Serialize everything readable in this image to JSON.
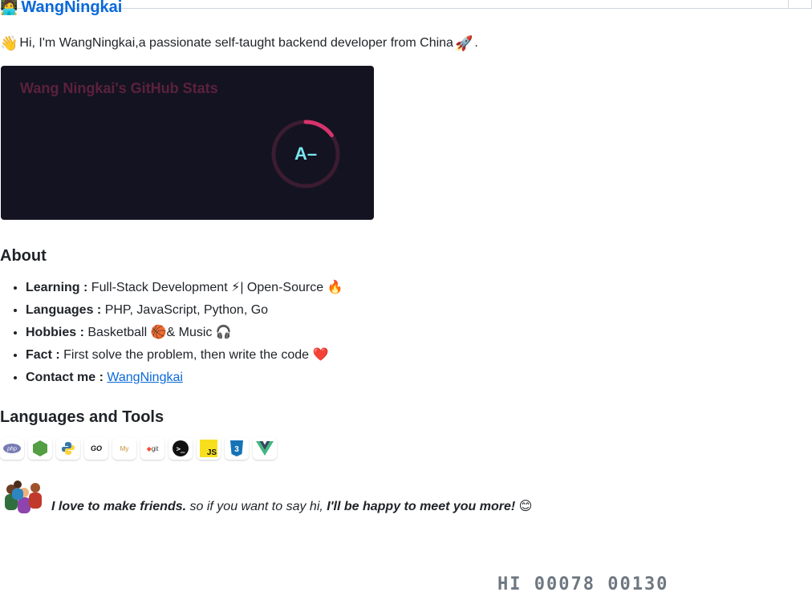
{
  "title": {
    "emoji": "🧑‍💻",
    "text": "WangNingkai"
  },
  "intro": {
    "lead_emoji": "👋",
    "text": "Hi, I'm WangNingkai,a passionate self-taught backend developer from China",
    "trail_emoji": "🚀",
    "trail_punct": "."
  },
  "stats_card": {
    "title": "Wang Ningkai's GitHub Stats",
    "rank": "A–",
    "rank_progress": 0.15,
    "colors": {
      "background": "#141321",
      "title": "#5b213c",
      "ring_track": "#3b1c30",
      "ring_progress": "#d6336c",
      "rank_text": "#79e7f0"
    }
  },
  "about": {
    "heading": "About",
    "items": [
      {
        "label": "Learning :",
        "value": "Full-Stack Development ⚡| Open-Source 🔥"
      },
      {
        "label": "Languages :",
        "value": "PHP, JavaScript, Python, Go"
      },
      {
        "label": "Hobbies :",
        "value": "Basketball 🏀& Music 🎧"
      },
      {
        "label": "Fact :",
        "value": "First solve the problem, then write the code ❤️"
      },
      {
        "label": "Contact me :",
        "link_text": "WangNingkai"
      }
    ]
  },
  "tools": {
    "heading": "Languages and Tools",
    "items": [
      {
        "name": "php-icon",
        "glyph": "php"
      },
      {
        "name": "nodejs-icon",
        "glyph": "⬢"
      },
      {
        "name": "python-icon",
        "glyph": "py"
      },
      {
        "name": "go-icon",
        "glyph": "GO"
      },
      {
        "name": "mysql-icon",
        "glyph": "My"
      },
      {
        "name": "git-icon",
        "glyph": "git"
      },
      {
        "name": "terminal-icon",
        "glyph": ">_"
      },
      {
        "name": "javascript-icon",
        "glyph": "JS"
      },
      {
        "name": "css3-icon",
        "glyph": "3"
      },
      {
        "name": "vue-icon",
        "glyph": "V"
      }
    ]
  },
  "friends": {
    "part1": "I love to make friends.",
    "part2": " so if you want to say hi, ",
    "part3": "I'll be happy to meet you more!",
    "emoji": " 😊"
  },
  "footer": {
    "counter": "HI 00078 00130"
  }
}
